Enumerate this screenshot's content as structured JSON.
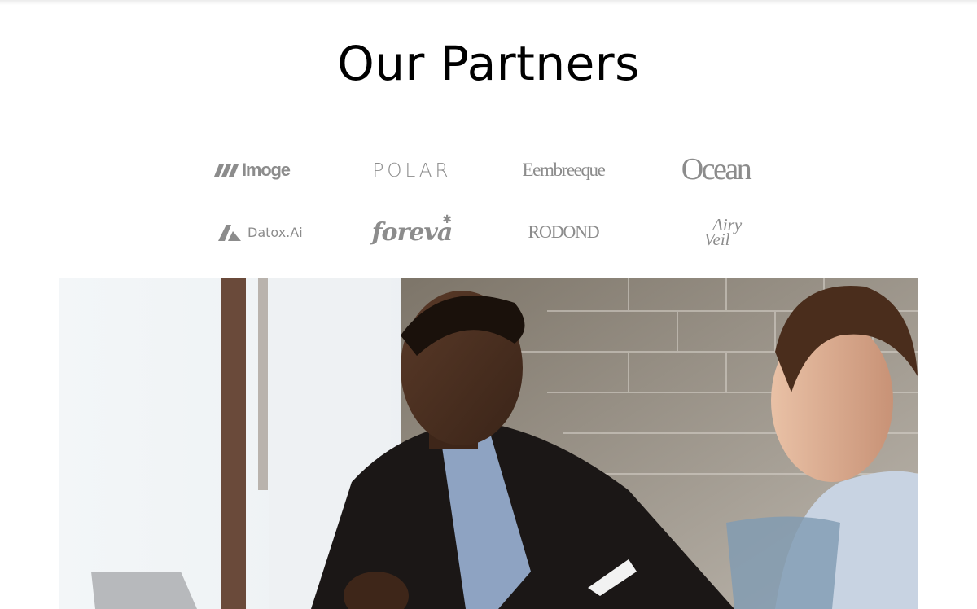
{
  "section": {
    "title": "Our Partners"
  },
  "partners": [
    {
      "name": "Imoge",
      "icon": "imoge-logo-icon"
    },
    {
      "name": "POLAR",
      "icon": "polar-logo-icon"
    },
    {
      "name": "Eembreeque",
      "icon": "eembreeque-logo-icon"
    },
    {
      "name": "Ocean",
      "icon": "ocean-logo-icon"
    },
    {
      "name": "Datox.Ai",
      "icon": "datox-logo-icon"
    },
    {
      "name": "foreva",
      "icon": "foreva-logo-icon"
    },
    {
      "name": "RODOND",
      "icon": "rodond-logo-icon"
    },
    {
      "name_line1": "Airy",
      "name_line2": "Veil",
      "icon": "airy-veil-logo-icon"
    }
  ],
  "colors": {
    "logo_gray": "#8c8c8c",
    "title": "#000000",
    "background": "#ffffff"
  }
}
